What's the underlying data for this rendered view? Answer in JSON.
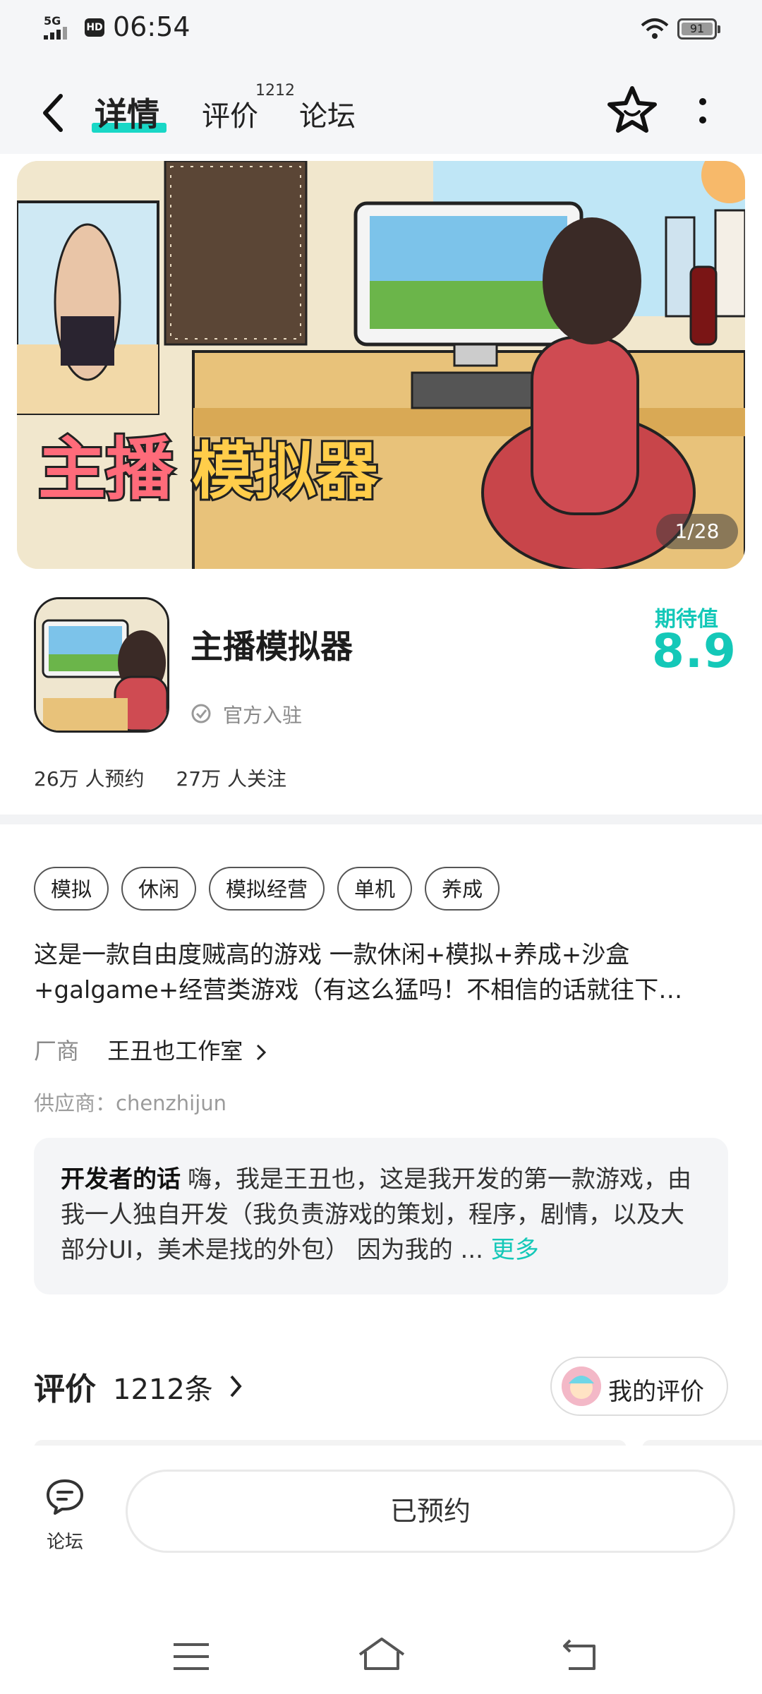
{
  "status_bar": {
    "network": "5G",
    "hd": "HD",
    "time": "06:54",
    "battery": "91"
  },
  "header": {
    "tabs": [
      {
        "label": "详情",
        "active": true
      },
      {
        "label": "评价",
        "badge": "1212"
      },
      {
        "label": "论坛"
      }
    ],
    "icons": [
      "back-icon",
      "star-icon",
      "more-icon"
    ]
  },
  "banner": {
    "title_art": "主播模拟器",
    "indicator": "1/28"
  },
  "app": {
    "name": "主播模拟器",
    "official": "官方入驻",
    "expectation_label": "期待值",
    "expectation_value": "8.9",
    "reservations": "26万 人预约",
    "followers": "27万 人关注"
  },
  "tags": [
    "模拟",
    "休闲",
    "模拟经营",
    "单机",
    "养成"
  ],
  "description": "这是一款自由度贼高的游戏 一款休闲+模拟+养成+沙盒+galgame+经营类游戏（有这么猛吗！不相信的话就往下…",
  "vendor": {
    "label": "厂商",
    "name": "王丑也工作室"
  },
  "supplier": "供应商：chenzhijun",
  "developer_note": {
    "heading": "开发者的话",
    "text": "嗨，我是王丑也，这是我开发的第一款游戏，由我一人独自开发（我负责游戏的策划，程序，剧情，以及大部分UI，美术是找的外包） 因为我的 ...",
    "more": "更多"
  },
  "reviews": {
    "title": "评价",
    "count": "1212条",
    "my_review": "我的评价"
  },
  "bottom": {
    "forum": "论坛",
    "action": "已预约"
  },
  "colors": {
    "accent": "#14c8b8"
  }
}
